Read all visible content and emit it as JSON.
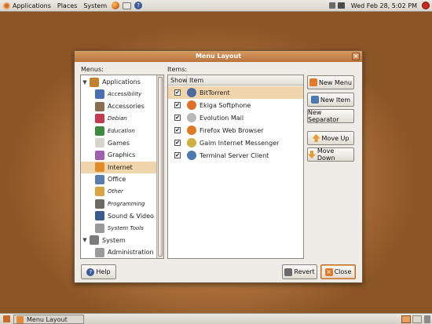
{
  "top_panel": {
    "applications": "Applications",
    "places": "Places",
    "system": "System",
    "datetime": "Wed Feb 28,  5:02 PM"
  },
  "window": {
    "title": "Menu Layout",
    "menus_label": "Menus:",
    "items_label": "Items:"
  },
  "menus": [
    {
      "label": "Applications",
      "level": 0,
      "expanded": true,
      "style": "normal",
      "icon_color": "#c0822c"
    },
    {
      "label": "Accessibility",
      "level": 1,
      "style": "italic",
      "icon_color": "#4a6fb5"
    },
    {
      "label": "Accessories",
      "level": 1,
      "style": "normal",
      "icon_color": "#8a6d4c"
    },
    {
      "label": "Debian",
      "level": 1,
      "style": "italic",
      "icon_color": "#c43a4e"
    },
    {
      "label": "Education",
      "level": 1,
      "style": "italic",
      "icon_color": "#3d8b3d"
    },
    {
      "label": "Games",
      "level": 1,
      "style": "normal",
      "icon_color": "#d8d4cc"
    },
    {
      "label": "Graphics",
      "level": 1,
      "style": "normal",
      "icon_color": "#a060b0"
    },
    {
      "label": "Internet",
      "level": 1,
      "style": "normal",
      "selected": true,
      "icon_color": "#e08a2a"
    },
    {
      "label": "Office",
      "level": 1,
      "style": "normal",
      "icon_color": "#5a7db0"
    },
    {
      "label": "Other",
      "level": 1,
      "style": "italic",
      "icon_color": "#d9a441"
    },
    {
      "label": "Programming",
      "level": 1,
      "style": "italic",
      "icon_color": "#6d6a63"
    },
    {
      "label": "Sound & Video",
      "level": 1,
      "style": "normal",
      "icon_color": "#3a5a90"
    },
    {
      "label": "System Tools",
      "level": 1,
      "style": "italic",
      "icon_color": "#9a9a9a"
    },
    {
      "label": "System",
      "level": 0,
      "expanded": true,
      "style": "normal",
      "icon_color": "#7a7a7a"
    },
    {
      "label": "Administration",
      "level": 1,
      "style": "normal",
      "icon_color": "#9a9a9a"
    }
  ],
  "items_table": {
    "col_show": "Show",
    "col_item": "Item"
  },
  "items": [
    {
      "label": "BitTorrent",
      "checked": "✔",
      "selected": true,
      "icon_color": "#4a6aa0"
    },
    {
      "label": "Ekiga Softphone",
      "checked": "✔",
      "icon_color": "#e0702a"
    },
    {
      "label": "Evolution Mail",
      "checked": "✔",
      "icon_color": "#b8b8b8"
    },
    {
      "label": "Firefox Web Browser",
      "checked": "✔",
      "icon_color": "#e07a20"
    },
    {
      "label": "Gaim Internet Messenger",
      "checked": "✔",
      "icon_color": "#d0b040"
    },
    {
      "label": "Terminal Server Client",
      "checked": "✔",
      "icon_color": "#4a7ab0"
    }
  ],
  "buttons": {
    "new_menu": "New Menu",
    "new_item": "New Item",
    "new_separator": "New Separator",
    "move_up": "Move Up",
    "move_down": "Move Down",
    "help": "Help",
    "revert": "Revert",
    "close": "Close"
  },
  "taskbar": {
    "task": "Menu Layout"
  }
}
